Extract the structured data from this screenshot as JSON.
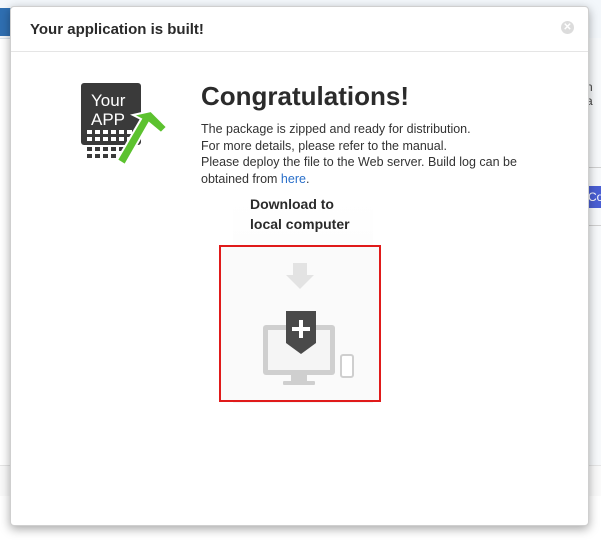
{
  "background": {
    "text_fragment": "n a",
    "button_fragment": "Co"
  },
  "dialog": {
    "title": "Your application is built!",
    "close_icon": "close-icon",
    "logo_text_line1": "Your",
    "logo_text_line2": "APP",
    "heading": "Congratulations!",
    "message": {
      "line1": "The package is zipped and ready for distribution.",
      "line2": "For more details, please refer to the manual.",
      "line3_prefix": "Please deploy the file to the Web server. Build log can be obtained from ",
      "link": "here",
      "line3_suffix": "."
    },
    "download": {
      "label_line1": "Download to",
      "label_line2": "local computer",
      "icon": "download-to-computer-icon"
    }
  },
  "colors": {
    "highlight_border": "#e01a1a",
    "link": "#2a6fc9",
    "logo_hammer": "#5cc22f"
  }
}
